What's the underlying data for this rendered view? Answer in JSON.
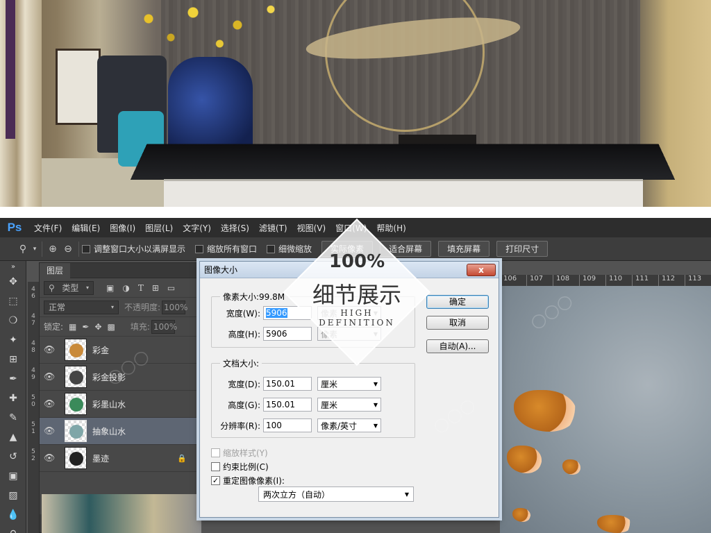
{
  "menubar": {
    "logo": "Ps",
    "items": [
      "文件(F)",
      "编辑(E)",
      "图像(I)",
      "图层(L)",
      "文字(Y)",
      "选择(S)",
      "滤镜(T)",
      "视图(V)",
      "窗口(W)",
      "帮助(H)"
    ]
  },
  "options": {
    "checkbox1": "调整窗口大小以满屏显示",
    "checkbox2": "缩放所有窗口",
    "checkbox3": "细微缩放",
    "btn_actual": "实际像素",
    "btn_fit": "适合屏幕",
    "btn_fill": "填充屏幕",
    "btn_print": "打印尺寸"
  },
  "vruler": [
    "4\n6",
    "4\n7",
    "4\n8",
    "4\n9",
    "5\n0",
    "5\n1",
    "5\n2"
  ],
  "hruler": [
    "106",
    "107",
    "108",
    "109",
    "110",
    "111",
    "112",
    "113"
  ],
  "layers_panel": {
    "tab": "图层",
    "filter_kind": "类型",
    "blend_mode": "正常",
    "opacity_label": "不透明度:",
    "opacity_value": "100%",
    "lock_label": "锁定:",
    "fill_label": "填充:",
    "fill_value": "100%",
    "layers": [
      {
        "name": "彩金",
        "selected": false,
        "locked": false,
        "thumb_color": "#c98a3a"
      },
      {
        "name": "彩金投影",
        "selected": false,
        "locked": false,
        "thumb_color": "#444444"
      },
      {
        "name": "彩墨山水",
        "selected": false,
        "locked": false,
        "thumb_color": "#3a8a5a"
      },
      {
        "name": "抽象山水",
        "selected": true,
        "locked": false,
        "thumb_color": "#7fa6a8"
      },
      {
        "name": "墨迹",
        "selected": false,
        "locked": true,
        "thumb_color": "#222222"
      }
    ],
    "footer_icons": [
      "link-icon",
      "fx-icon",
      "mask-icon",
      "adjustment-icon",
      "folder-icon",
      "new-layer-icon",
      "trash-icon"
    ]
  },
  "dialog": {
    "title": "图像大小",
    "close": "x",
    "pixel_group_title": "像素大小:99.8M",
    "px_width_label": "宽度(W):",
    "px_width_value": "5906",
    "px_width_unit": "像素",
    "px_height_label": "高度(H):",
    "px_height_value": "5906",
    "px_height_unit": "像素",
    "doc_group_title": "文档大小:",
    "doc_width_label": "宽度(D):",
    "doc_width_value": "150.01",
    "doc_width_unit": "厘米",
    "doc_height_label": "高度(G):",
    "doc_height_value": "150.01",
    "doc_height_unit": "厘米",
    "res_label": "分辨率(R):",
    "res_value": "100",
    "res_unit": "像素/英寸",
    "scale_styles": "缩放样式(Y)",
    "constrain": "约束比例(C)",
    "resample": "重定图像像素(I):",
    "resample_method": "两次立方（自动）",
    "btn_ok": "确定",
    "btn_cancel": "取消",
    "btn_auto": "自动(A)..."
  },
  "badge": {
    "line1": "100%",
    "line2": "细节展示",
    "line3": "HIGH",
    "line4": "DEFINITION"
  }
}
